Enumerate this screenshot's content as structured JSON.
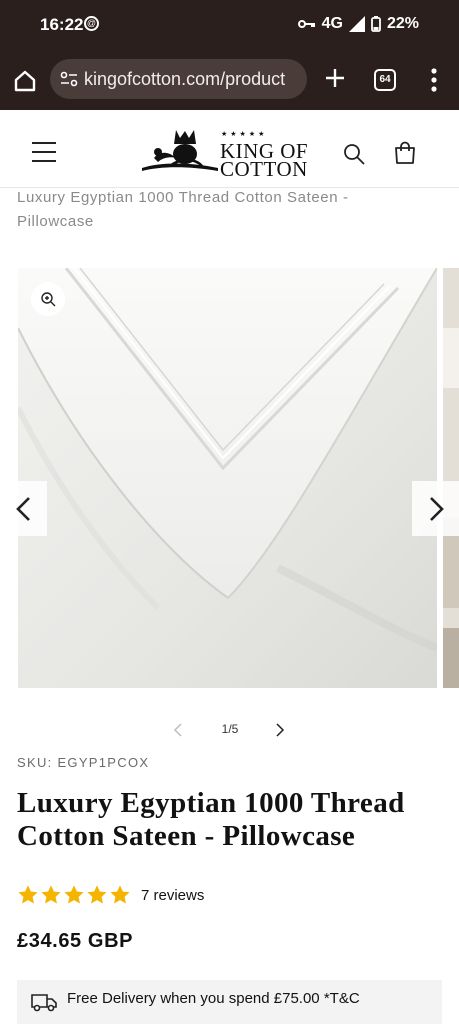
{
  "status_bar": {
    "time": "16:22",
    "network": "4G",
    "battery": "22%"
  },
  "browser": {
    "url": "kingofcotton.com/product",
    "tab_count": "64",
    "icons": [
      "home-icon",
      "site-settings-icon",
      "plus-icon",
      "tabs-icon",
      "more-vert-icon"
    ]
  },
  "header": {
    "logo_line1": "KING OF",
    "logo_line2": "COTTON",
    "logo_stars": "★★★★★",
    "icons": [
      "hamburger-icon",
      "search-icon",
      "cart-icon"
    ]
  },
  "breadcrumb_title": "Luxury Egyptian 1000 Thread Cotton Sateen - Pillowcase",
  "gallery": {
    "counter": "1/5",
    "icons": [
      "zoom-icon",
      "chevron-left-icon",
      "chevron-right-icon"
    ]
  },
  "product": {
    "sku": "SKU: EGYP1PCOX",
    "title": "Luxury Egyptian 1000 Thread Cotton Sateen - Pillowcase",
    "rating": 5,
    "reviews": "7 reviews",
    "price": "£34.65 GBP",
    "delivery_text": "Free Delivery when you spend £75.00 *T&C"
  },
  "colors": {
    "status_bar_bg": "#2a1f1c",
    "star": "#f5b400",
    "text": "#121212"
  }
}
